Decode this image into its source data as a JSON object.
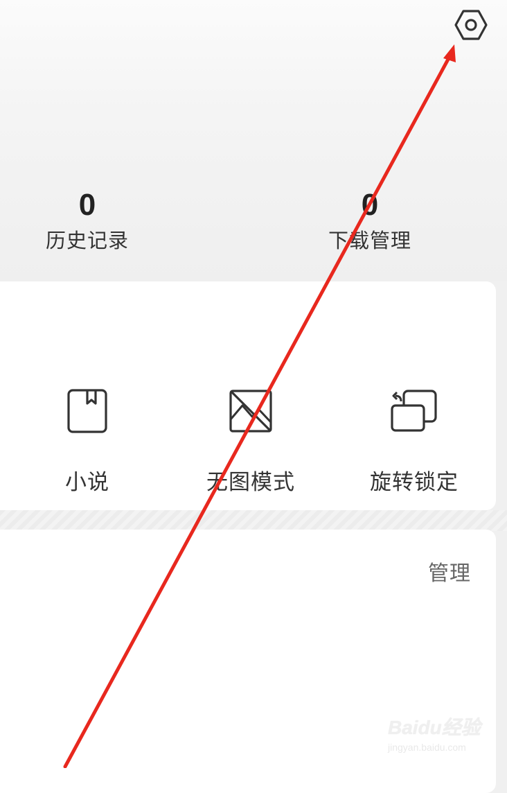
{
  "header": {
    "settings_icon": "gear-hexagon-icon"
  },
  "stats": [
    {
      "count": "0",
      "label": "历史记录"
    },
    {
      "count": "0",
      "label": "下载管理"
    }
  ],
  "tools": [
    {
      "label": "小说",
      "icon": "book-icon"
    },
    {
      "label": "无图模式",
      "icon": "no-image-icon"
    },
    {
      "label": "旋转锁定",
      "icon": "rotate-lock-icon"
    }
  ],
  "section": {
    "manage_label": "管理"
  },
  "annotation": {
    "arrow_color": "#e8281e"
  },
  "watermark": {
    "logo": "Baidu经验",
    "url": "jingyan.baidu.com"
  }
}
